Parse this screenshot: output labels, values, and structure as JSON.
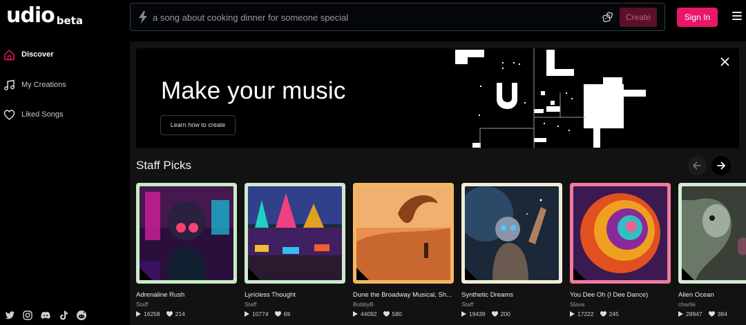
{
  "app": {
    "logo_text": "udio",
    "logo_suffix": "beta"
  },
  "search": {
    "placeholder": "a song about cooking dinner for someone special",
    "create_label": "Create"
  },
  "header": {
    "signin_label": "Sign In"
  },
  "sidebar": {
    "items": [
      {
        "label": "Discover",
        "icon": "home-icon",
        "active": true
      },
      {
        "label": "My Creations",
        "icon": "music-note-icon",
        "active": false
      },
      {
        "label": "Liked Songs",
        "icon": "heart-icon",
        "active": false
      }
    ],
    "socials": [
      "twitter-icon",
      "instagram-icon",
      "discord-icon",
      "tiktok-icon",
      "reddit-icon"
    ]
  },
  "hero": {
    "title": "Make your music",
    "button_label": "Learn how to create"
  },
  "staff_picks": {
    "title": "Staff Picks",
    "cards": [
      {
        "title": "Adrenaline Rush",
        "artist": "Staff",
        "plays": "16258",
        "likes": "214",
        "frame_color": "#c8ecc8"
      },
      {
        "title": "Lyricless Thought",
        "artist": "Staff",
        "plays": "10774",
        "likes": "69",
        "frame_color": "#cfe8cf"
      },
      {
        "title": "Dune the Broadway Musical, Sh...",
        "artist": "BobbyB",
        "plays": "44092",
        "likes": "580",
        "frame_color": "#f4b860"
      },
      {
        "title": "Synthetic Dreams",
        "artist": "Staff",
        "plays": "19439",
        "likes": "200",
        "frame_color": "#f0ecd8"
      },
      {
        "title": "You Dee Oh (I Dee Dance)",
        "artist": "Slava",
        "plays": "17222",
        "likes": "245",
        "frame_color": "#f07aa0"
      },
      {
        "title": "Alien Ocean",
        "artist": "charlie",
        "plays": "28947",
        "likes": "384",
        "frame_color": "#d4ecd4"
      }
    ]
  },
  "colors": {
    "accent": "#e8176a",
    "create_disabled": "#5a1028",
    "background": "#000000",
    "panel": "#121212"
  }
}
